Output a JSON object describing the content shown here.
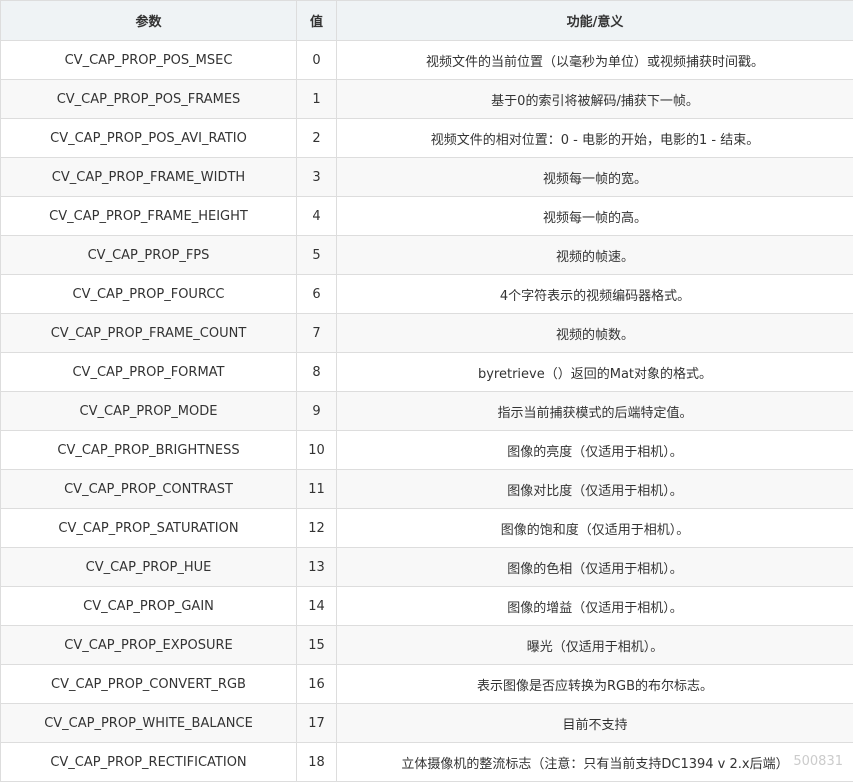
{
  "table": {
    "headers": [
      "参数",
      "值",
      "功能/意义"
    ],
    "rows": [
      {
        "param": "CV_CAP_PROP_POS_MSEC",
        "value": "0",
        "meaning": "视频文件的当前位置（以毫秒为单位）或视频捕获时间戳。"
      },
      {
        "param": "CV_CAP_PROP_POS_FRAMES",
        "value": "1",
        "meaning": "基于0的索引将被解码/捕获下一帧。"
      },
      {
        "param": "CV_CAP_PROP_POS_AVI_RATIO",
        "value": "2",
        "meaning": "视频文件的相对位置：0 - 电影的开始，电影的1 - 结束。"
      },
      {
        "param": "CV_CAP_PROP_FRAME_WIDTH",
        "value": "3",
        "meaning": "视频每一帧的宽。"
      },
      {
        "param": "CV_CAP_PROP_FRAME_HEIGHT",
        "value": "4",
        "meaning": "视频每一帧的高。"
      },
      {
        "param": "CV_CAP_PROP_FPS",
        "value": "5",
        "meaning": "视频的帧速。"
      },
      {
        "param": "CV_CAP_PROP_FOURCC",
        "value": "6",
        "meaning": "4个字符表示的视频编码器格式。"
      },
      {
        "param": "CV_CAP_PROP_FRAME_COUNT",
        "value": "7",
        "meaning": "视频的帧数。"
      },
      {
        "param": "CV_CAP_PROP_FORMAT",
        "value": "8",
        "meaning": "byretrieve（）返回的Mat对象的格式。"
      },
      {
        "param": "CV_CAP_PROP_MODE",
        "value": "9",
        "meaning": "指示当前捕获模式的后端特定值。"
      },
      {
        "param": "CV_CAP_PROP_BRIGHTNESS",
        "value": "10",
        "meaning": "图像的亮度（仅适用于相机）。"
      },
      {
        "param": "CV_CAP_PROP_CONTRAST",
        "value": "11",
        "meaning": "图像对比度（仅适用于相机）。"
      },
      {
        "param": "CV_CAP_PROP_SATURATION",
        "value": "12",
        "meaning": "图像的饱和度（仅适用于相机）。"
      },
      {
        "param": "CV_CAP_PROP_HUE",
        "value": "13",
        "meaning": "图像的色相（仅适用于相机）。"
      },
      {
        "param": "CV_CAP_PROP_GAIN",
        "value": "14",
        "meaning": "图像的增益（仅适用于相机）。"
      },
      {
        "param": "CV_CAP_PROP_EXPOSURE",
        "value": "15",
        "meaning": "曝光（仅适用于相机）。"
      },
      {
        "param": "CV_CAP_PROP_CONVERT_RGB",
        "value": "16",
        "meaning": "表示图像是否应转换为RGB的布尔标志。"
      },
      {
        "param": "CV_CAP_PROP_WHITE_BALANCE",
        "value": "17",
        "meaning": "目前不支持"
      },
      {
        "param": "CV_CAP_PROP_RECTIFICATION",
        "value": "18",
        "meaning": "立体摄像机的整流标志（注意：只有当前支持DC1394 v 2.x后端）"
      }
    ]
  },
  "watermark": "500831",
  "colors": {
    "header_bg": "#eff3f5",
    "border": "#dddddd",
    "row_alt_bg": "#f8f8f8",
    "text": "#333333"
  }
}
